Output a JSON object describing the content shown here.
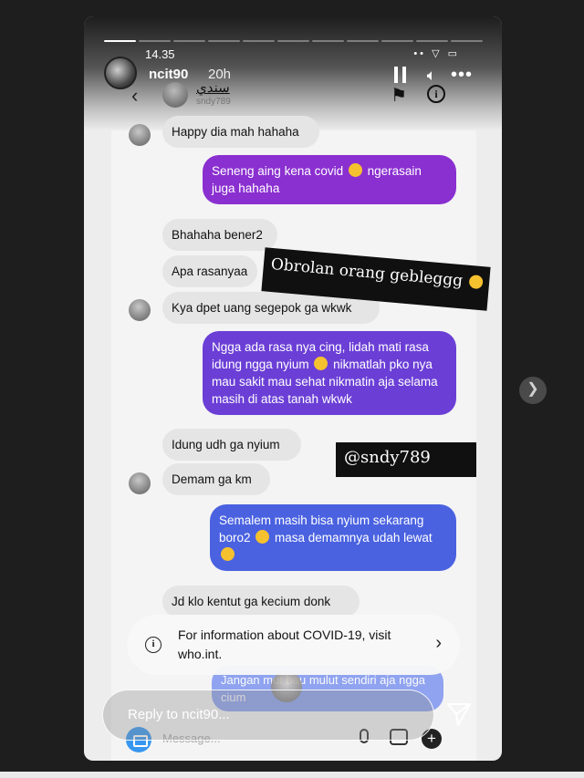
{
  "story": {
    "status_time": "14.35",
    "username": "ncit90",
    "time_ago": "20h",
    "progress_segments": 11,
    "active_segment": 0
  },
  "dm_header": {
    "name": "سندي",
    "handle": "sndy789"
  },
  "messages": [
    {
      "dir": "in",
      "text": "Happy dia mah hahaha"
    },
    {
      "dir": "out",
      "text": "Seneng aing kena covid  ngerasain juga hahaha"
    },
    {
      "dir": "in",
      "text": "Bhahaha bener2"
    },
    {
      "dir": "in",
      "text": "Apa rasanyaa"
    },
    {
      "dir": "in",
      "text": "Kya dpet uang segepok ga wkwk"
    },
    {
      "dir": "out",
      "text": "Ngga ada rasa nya cing, lidah mati rasa idung ngga nyium  nikmatlah pko nya mau sakit mau sehat nikmatin aja selama masih di atas tanah wkwk"
    },
    {
      "dir": "in",
      "text": "Idung udh ga nyium"
    },
    {
      "dir": "in",
      "text": "Demam ga km"
    },
    {
      "dir": "out",
      "text": "Semalem masih bisa nyium sekarang boro2  masa demamnya udah lewat "
    },
    {
      "dir": "in",
      "text": "Jd klo kentut ga kecium donk"
    },
    {
      "dir": "out",
      "text": "Jangan  mut bau mulut sendiri aja ngga  cium"
    }
  ],
  "stickers": {
    "caption": "Obrolan orang gebleggg",
    "tag": "@sndy789"
  },
  "covid_banner": {
    "text": "For information about COVID-19, visit who.int."
  },
  "reply": {
    "placeholder": "Reply to ncit90..."
  },
  "message_bar": {
    "placeholder": "Message..."
  },
  "colors": {
    "bubble_in": "#e5e5e5",
    "bubble_purple": "#8a2fd0",
    "bubble_violet": "#6b3fd6",
    "bubble_blue": "#4a62e0"
  }
}
